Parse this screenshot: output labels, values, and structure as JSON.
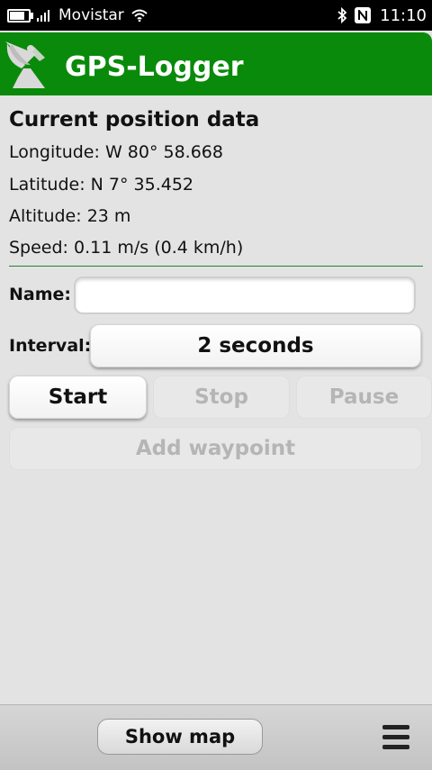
{
  "status_bar": {
    "carrier": "Movistar",
    "time": "11:10",
    "battery_level": 0.8,
    "nfc_label": "N"
  },
  "header": {
    "title": "GPS-Logger",
    "logo_icon": "satellite-dish-icon",
    "color": "#0a8a0a"
  },
  "position": {
    "section_title": "Current position data",
    "longitude": "Longitude: W 80° 58.668",
    "latitude": "Latitude: N 7° 35.452",
    "altitude": "Altitude: 23 m",
    "speed": "Speed: 0.11 m/s (0.4 km/h)"
  },
  "form": {
    "name_label": "Name:",
    "name_value": "",
    "interval_label": "Interval:",
    "interval_value": "2 seconds"
  },
  "controls": {
    "start": "Start",
    "stop": "Stop",
    "pause": "Pause",
    "add_waypoint": "Add waypoint"
  },
  "toolbar": {
    "show_map": "Show map",
    "menu_icon": "menu-icon"
  }
}
